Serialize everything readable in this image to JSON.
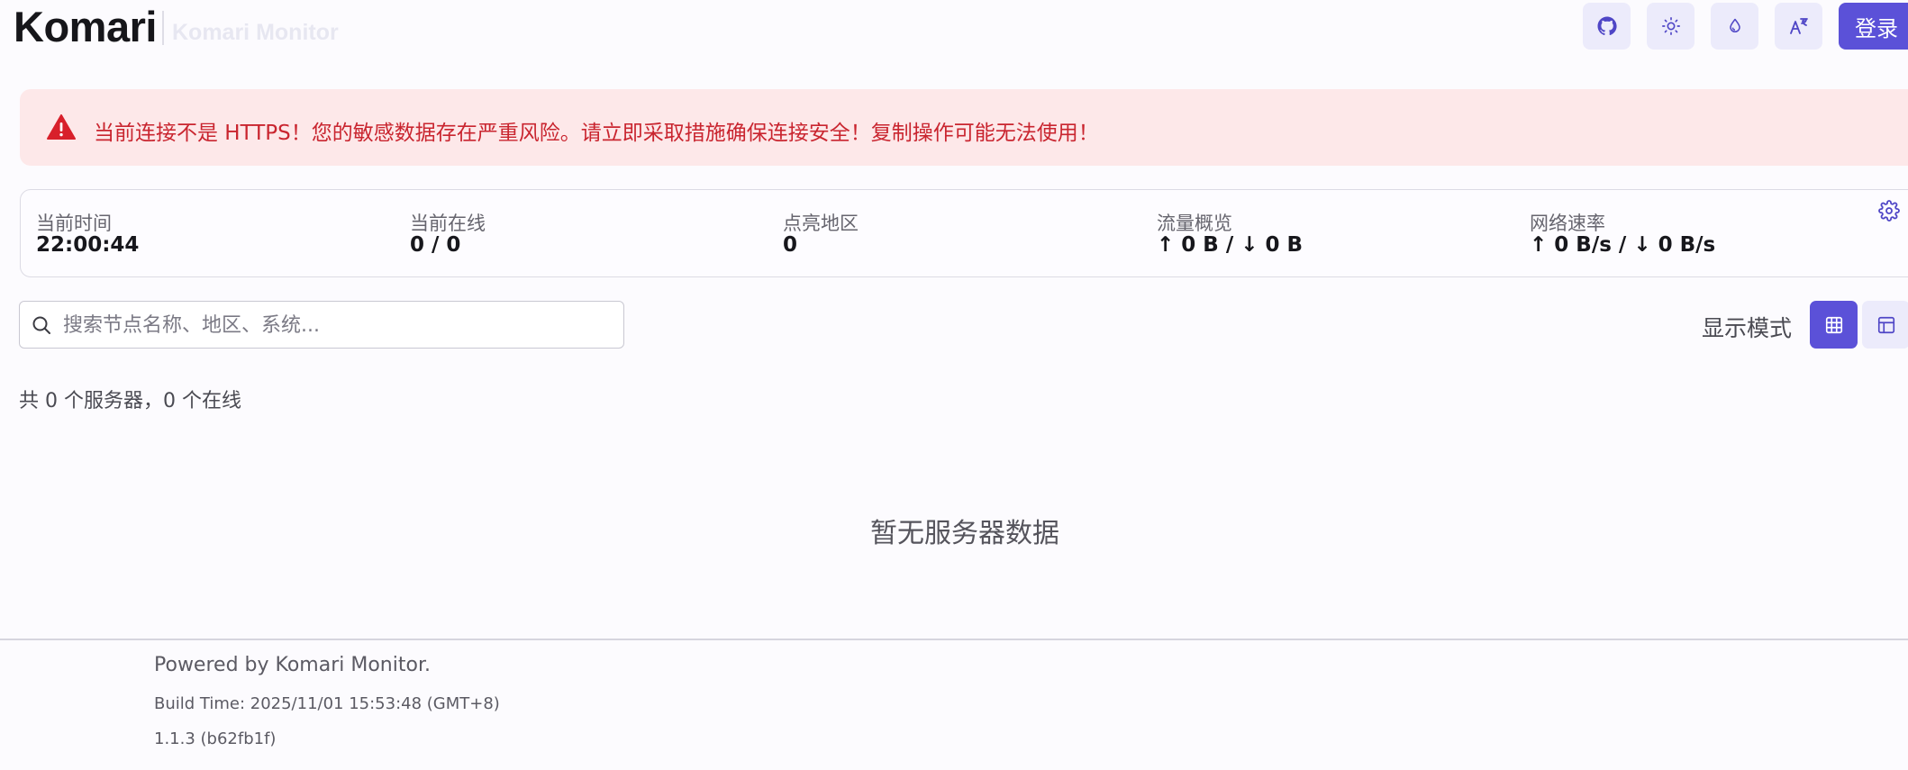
{
  "header": {
    "brand": "Komari",
    "subtitle": "Komari Monitor",
    "buttons": {
      "github_icon": "github-icon",
      "theme_icon": "sun-icon",
      "color_icon": "droplet-icon",
      "language_icon": "translate-icon"
    },
    "login_label": "登录"
  },
  "alert": {
    "icon": "warning-icon",
    "message": "当前连接不是 HTTPS！您的敏感数据存在严重风险。请立即采取措施确保连接安全！复制操作可能无法使用！",
    "color": "#c9252f",
    "background": "#fde8e9"
  },
  "stats": [
    {
      "label": "当前时间",
      "value": "22:00:44"
    },
    {
      "label": "当前在线",
      "value": "0 / 0"
    },
    {
      "label": "点亮地区",
      "value": "0"
    },
    {
      "label": "流量概览",
      "value": "↑ 0 B / ↓ 0 B"
    },
    {
      "label": "网络速率",
      "value": "↑ 0 B/s / ↓ 0 B/s"
    }
  ],
  "search": {
    "placeholder": "搜索节点名称、地区、系统...",
    "value": ""
  },
  "view_mode": {
    "label": "显示模式",
    "active": "grid"
  },
  "summary": "共 0 个服务器，0 个在线",
  "empty_message": "暂无服务器数据",
  "footer": {
    "powered_by": "Powered by Komari Monitor.",
    "build_time": "Build Time: 2025/11/01 15:53:48 (GMT+8)",
    "version": "1.1.3 (b62fb1f)"
  },
  "colors": {
    "accent": "#5b51d8",
    "accent_soft": "#ecebfb",
    "background": "#fcfbfe"
  }
}
